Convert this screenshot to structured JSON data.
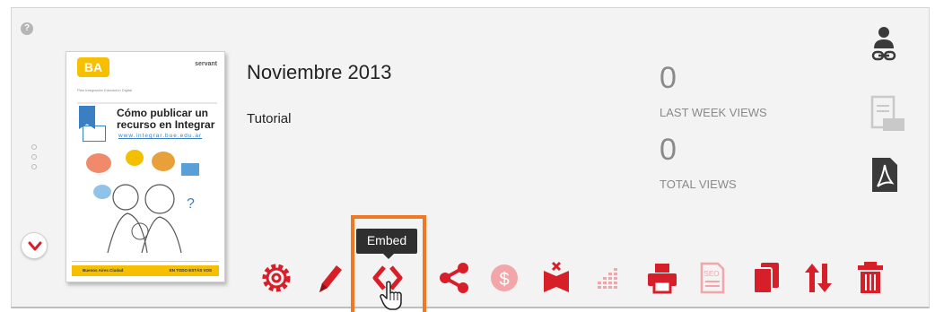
{
  "colors": {
    "accent": "#d71f2a",
    "faded": "#f2a6aa",
    "tooltip_border": "#f07822",
    "stat": "#8a8a8a",
    "side_icon": "#3a3a3a"
  },
  "help": {
    "glyph": "?"
  },
  "publication": {
    "title": "Noviembre 2013",
    "type": "Tutorial",
    "thumbnail": {
      "logo": "BA",
      "partner": "servant",
      "kicker": "Plan Integración Educación Digital",
      "doc_title": "Cómo publicar un recurso en Integrar",
      "doc_url": "www.integrar.bue.edu.ar",
      "footer_left": "Buenos Aires Ciudad",
      "footer_right": "EN TODO ESTÁS VOS"
    }
  },
  "stats": [
    {
      "value": "0",
      "label": "LAST WEEK VIEWS"
    },
    {
      "value": "0",
      "label": "TOTAL VIEWS"
    }
  ],
  "side_icons": [
    "user-link-icon",
    "embed-document-icon",
    "pdf-icon"
  ],
  "toolbar": {
    "tooltip": "Embed",
    "tools": [
      {
        "icon": "gear-icon",
        "state": "active"
      },
      {
        "icon": "pencil-icon",
        "state": "active"
      },
      {
        "icon": "embed-code-icon",
        "state": "active"
      },
      {
        "icon": "share-icon",
        "state": "active"
      },
      {
        "icon": "dollar-icon",
        "state": "faded"
      },
      {
        "icon": "book-remove-icon",
        "state": "active"
      },
      {
        "icon": "stats-icon",
        "state": "faded"
      },
      {
        "icon": "print-icon",
        "state": "active"
      },
      {
        "icon": "seo-icon",
        "state": "faded"
      },
      {
        "icon": "copy-icon",
        "state": "active"
      },
      {
        "icon": "sort-icon",
        "state": "active"
      },
      {
        "icon": "trash-icon",
        "state": "active"
      }
    ]
  }
}
